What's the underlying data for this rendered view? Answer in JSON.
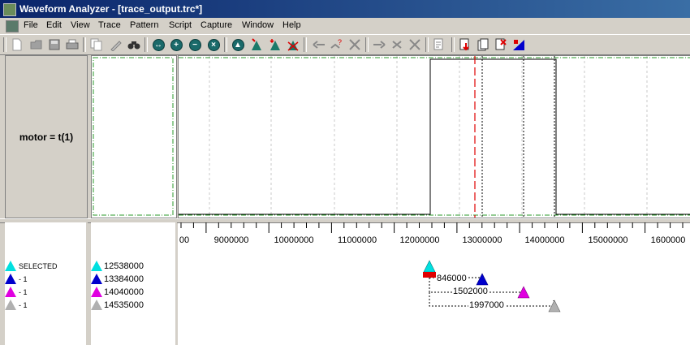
{
  "window": {
    "title": "Waveform Analyzer - [trace_output.trc*]"
  },
  "menu": [
    "File",
    "Edit",
    "View",
    "Trace",
    "Pattern",
    "Script",
    "Capture",
    "Window",
    "Help"
  ],
  "toolbar": {
    "icons": [
      "new-icon",
      "open-icon",
      "save-icon",
      "print-icon",
      "copy-icon",
      "edit-icon",
      "find-icon",
      "nav-left-right-icon",
      "zoom-in-icon",
      "zoom-out-icon",
      "zoom-fit-icon",
      "marker-up-icon",
      "marker-set-icon",
      "marker-next-icon",
      "marker-delete-icon",
      "edge-prev-icon",
      "edge-query-icon",
      "edge-clear-icon",
      "step-forward-icon",
      "step-next-icon",
      "step-clear-icon",
      "report-icon",
      "export-red-icon",
      "export-page-icon",
      "export-delete-icon",
      "export-chart-icon"
    ]
  },
  "signal": {
    "name": "motor = t(1)"
  },
  "cursors": {
    "labels": [
      {
        "text": "SELECTED",
        "color": "#00e0e0"
      },
      {
        "text": "- 1",
        "color": "#0000cc"
      },
      {
        "text": "- 1",
        "color": "#e000e0"
      },
      {
        "text": "- 1",
        "color": "#b0b0b0"
      }
    ],
    "values": [
      {
        "text": "12538000",
        "color": "#00e0e0"
      },
      {
        "text": "13384000",
        "color": "#0000cc"
      },
      {
        "text": "14040000",
        "color": "#e000e0"
      },
      {
        "text": "14535000",
        "color": "#b0b0b0"
      }
    ]
  },
  "timeline": {
    "tick_labels": [
      "00",
      "9000000",
      "10000000",
      "11000000",
      "12000000",
      "13000000",
      "14000000",
      "15000000",
      "1600000"
    ],
    "deltas": [
      "846000",
      "1502000",
      "1997000"
    ]
  },
  "colors": {
    "selected": "#00e0e0",
    "cursor2": "#0000cc",
    "cursor3": "#e000e0",
    "cursor4": "#b0b0b0",
    "marker": "#e00000",
    "grid_green": "#2a9a2a"
  }
}
